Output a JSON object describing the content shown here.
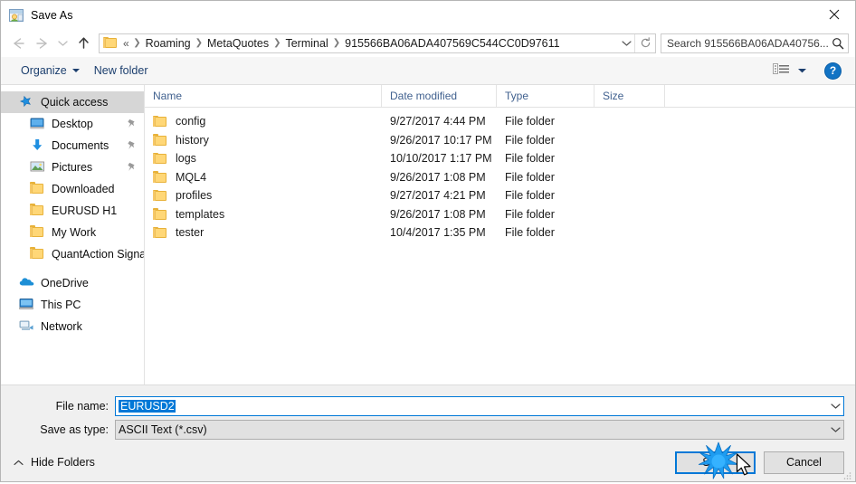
{
  "window": {
    "title": "Save As",
    "title_icon": "save-as-icon",
    "close_label": "✕"
  },
  "nav": {
    "back_icon": "arrow-left-icon",
    "forward_icon": "arrow-right-icon",
    "recent_icon": "chevron-down-icon",
    "up_icon": "arrow-up-icon",
    "folder_icon": "folder-icon",
    "breadcrumbs": [
      "«",
      "Roaming",
      "MetaQuotes",
      "Terminal",
      "915566BA06ADA407569C544CC0D97611"
    ],
    "dropdown_icon": "chevron-down-icon",
    "refresh_icon": "refresh-icon"
  },
  "search": {
    "placeholder": "Search 915566BA06ADA40756...",
    "icon": "search-icon"
  },
  "toolbar": {
    "organize_label": "Organize",
    "new_folder_label": "New folder",
    "view_icon": "view-options-icon",
    "view_caret_icon": "chevron-down-icon",
    "help_label": "?"
  },
  "sidebar": {
    "items": [
      {
        "label": "Quick access",
        "icon": "star-pin-icon",
        "selected": true,
        "indent": false,
        "pinned": false
      },
      {
        "label": "Desktop",
        "icon": "desktop-icon",
        "selected": false,
        "indent": true,
        "pinned": true
      },
      {
        "label": "Documents",
        "icon": "documents-icon",
        "selected": false,
        "indent": true,
        "pinned": true
      },
      {
        "label": "Pictures",
        "icon": "pictures-icon",
        "selected": false,
        "indent": true,
        "pinned": true
      },
      {
        "label": "Downloaded",
        "icon": "folder-icon",
        "selected": false,
        "indent": true,
        "pinned": false
      },
      {
        "label": "EURUSD H1",
        "icon": "folder-icon",
        "selected": false,
        "indent": true,
        "pinned": false
      },
      {
        "label": "My Work",
        "icon": "folder-icon",
        "selected": false,
        "indent": true,
        "pinned": false
      },
      {
        "label": "QuantAction Signal",
        "icon": "folder-icon",
        "selected": false,
        "indent": true,
        "pinned": false
      }
    ],
    "roots": [
      {
        "label": "OneDrive",
        "icon": "onedrive-icon"
      },
      {
        "label": "This PC",
        "icon": "this-pc-icon"
      },
      {
        "label": "Network",
        "icon": "network-icon"
      }
    ]
  },
  "filelist": {
    "columns": {
      "name": "Name",
      "date_modified": "Date modified",
      "type": "Type",
      "size": "Size"
    },
    "sort": {
      "column": "Name",
      "direction": "ascending"
    },
    "rows": [
      {
        "name": "config",
        "date": "9/27/2017 4:44 PM",
        "type": "File folder",
        "size": "",
        "icon": "folder-icon"
      },
      {
        "name": "history",
        "date": "9/26/2017 10:17 PM",
        "type": "File folder",
        "size": "",
        "icon": "folder-icon"
      },
      {
        "name": "logs",
        "date": "10/10/2017 1:17 PM",
        "type": "File folder",
        "size": "",
        "icon": "folder-icon"
      },
      {
        "name": "MQL4",
        "date": "9/26/2017 1:08 PM",
        "type": "File folder",
        "size": "",
        "icon": "folder-icon"
      },
      {
        "name": "profiles",
        "date": "9/27/2017 4:21 PM",
        "type": "File folder",
        "size": "",
        "icon": "folder-icon"
      },
      {
        "name": "templates",
        "date": "9/26/2017 1:08 PM",
        "type": "File folder",
        "size": "",
        "icon": "folder-icon"
      },
      {
        "name": "tester",
        "date": "10/4/2017 1:35 PM",
        "type": "File folder",
        "size": "",
        "icon": "folder-icon"
      }
    ]
  },
  "form": {
    "filename_label": "File name:",
    "filename_value": "EURUSD2",
    "filetype_label": "Save as type:",
    "filetype_value": "ASCII Text (*.csv)",
    "dropdown_icon": "chevron-down-icon"
  },
  "footer": {
    "hide_folders_label": "Hide Folders",
    "hide_folders_icon": "chevron-up-icon",
    "save_label": "Save",
    "cancel_label": "Cancel"
  },
  "colors": {
    "accent": "#0078d7",
    "selection": "#0078d7",
    "sidebar_selected": "#d6d6d6",
    "toolbar_bg": "#f6f6f6",
    "bottom_bg": "#f0f0f0",
    "column_header_text": "#41618f",
    "folder_yellow": "#ffd777"
  }
}
